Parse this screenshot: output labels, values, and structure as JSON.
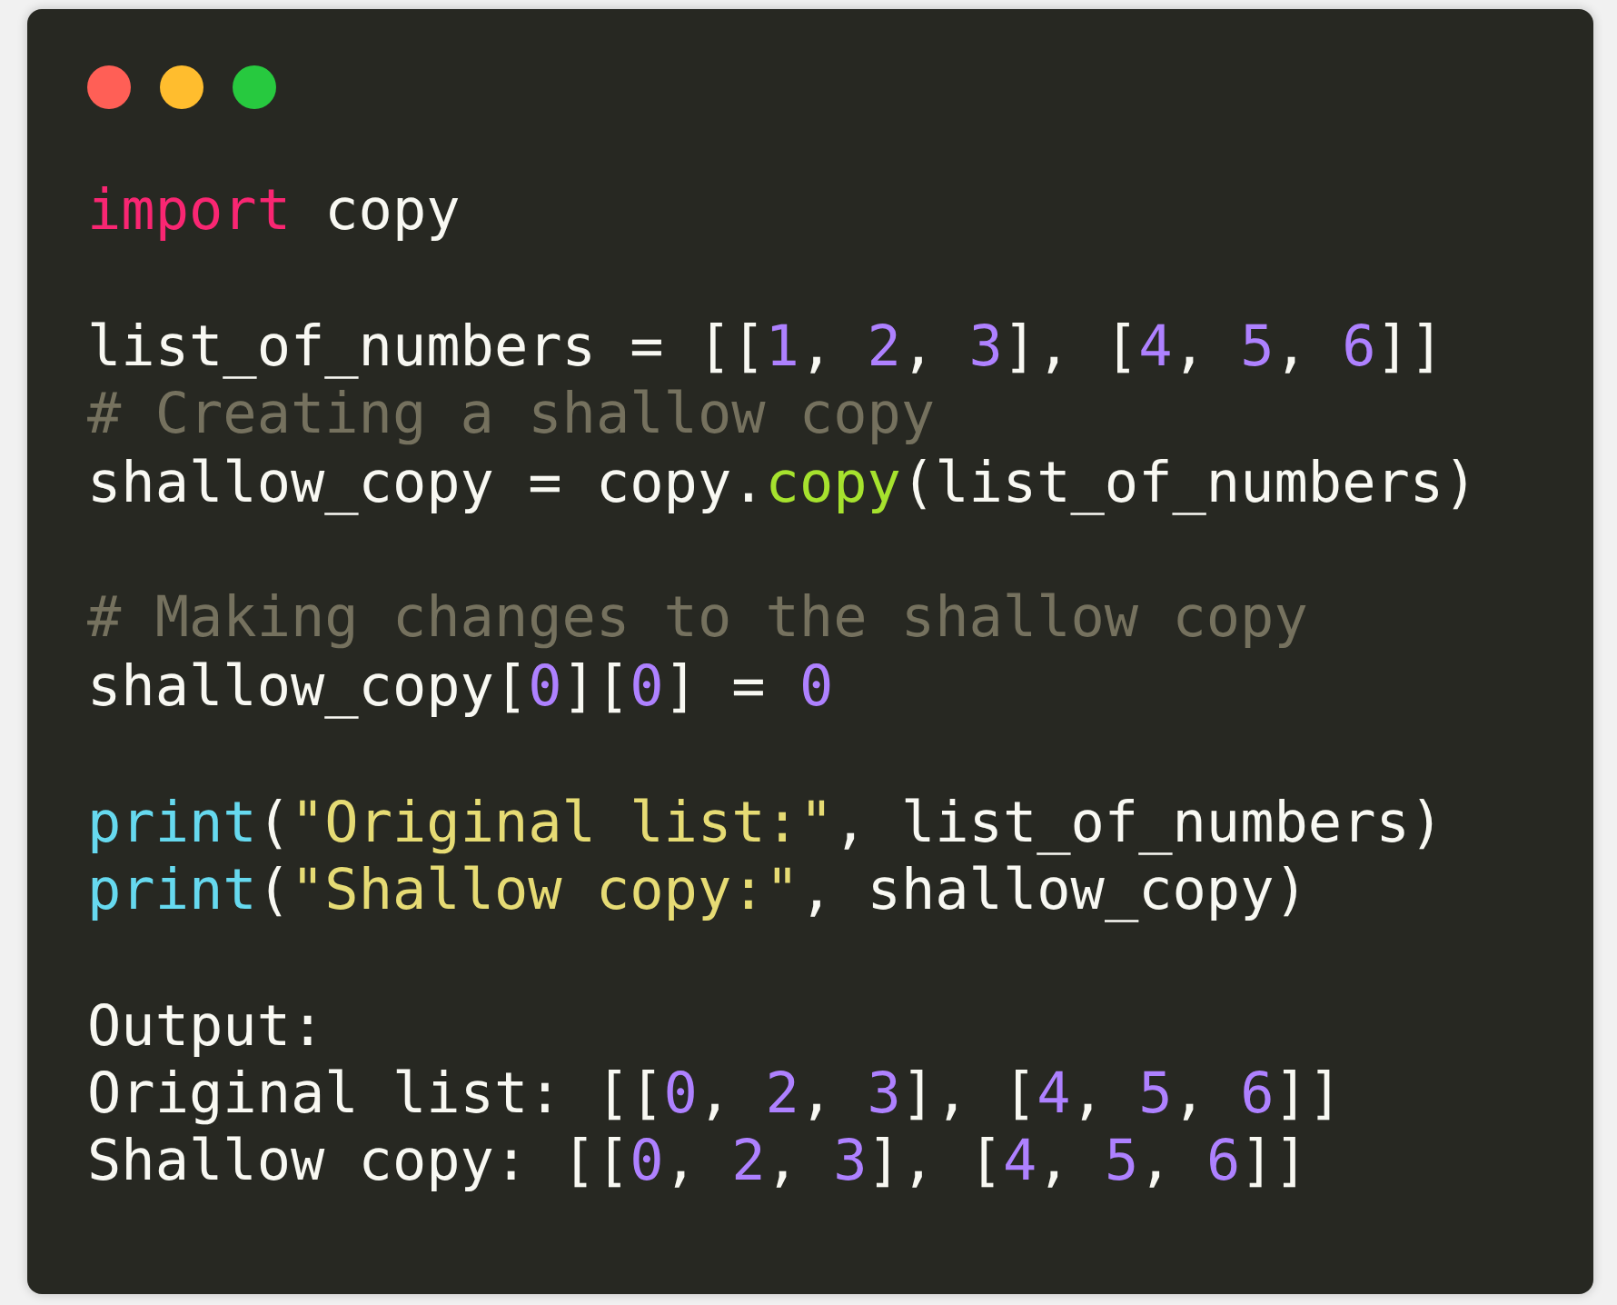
{
  "window_controls": [
    {
      "color": "#ff5f56"
    },
    {
      "color": "#ffbd2e"
    },
    {
      "color": "#27c93f"
    }
  ],
  "code_blocks": [
    [
      {
        "tokens": [
          {
            "kind": "keyword",
            "text": "import"
          },
          {
            "kind": "plain",
            "text": " copy"
          }
        ]
      }
    ],
    [
      {
        "tokens": [
          {
            "kind": "plain",
            "text": "list_of_numbers = [["
          },
          {
            "kind": "number",
            "text": "1"
          },
          {
            "kind": "plain",
            "text": ", "
          },
          {
            "kind": "number",
            "text": "2"
          },
          {
            "kind": "plain",
            "text": ", "
          },
          {
            "kind": "number",
            "text": "3"
          },
          {
            "kind": "plain",
            "text": "], ["
          },
          {
            "kind": "number",
            "text": "4"
          },
          {
            "kind": "plain",
            "text": ", "
          },
          {
            "kind": "number",
            "text": "5"
          },
          {
            "kind": "plain",
            "text": ", "
          },
          {
            "kind": "number",
            "text": "6"
          },
          {
            "kind": "plain",
            "text": "]]"
          }
        ]
      },
      {
        "tokens": [
          {
            "kind": "comment",
            "text": "# Creating a shallow copy"
          }
        ]
      },
      {
        "tokens": [
          {
            "kind": "plain",
            "text": "shallow_copy = copy."
          },
          {
            "kind": "function",
            "text": "copy"
          },
          {
            "kind": "plain",
            "text": "(list_of_numbers)"
          }
        ]
      }
    ],
    [
      {
        "tokens": [
          {
            "kind": "comment",
            "text": "# Making changes to the shallow copy"
          }
        ]
      },
      {
        "tokens": [
          {
            "kind": "plain",
            "text": "shallow_copy["
          },
          {
            "kind": "number",
            "text": "0"
          },
          {
            "kind": "plain",
            "text": "]["
          },
          {
            "kind": "number",
            "text": "0"
          },
          {
            "kind": "plain",
            "text": "] = "
          },
          {
            "kind": "number",
            "text": "0"
          }
        ]
      }
    ],
    [
      {
        "tokens": [
          {
            "kind": "builtin",
            "text": "print"
          },
          {
            "kind": "plain",
            "text": "("
          },
          {
            "kind": "string",
            "text": "\"Original list:\""
          },
          {
            "kind": "plain",
            "text": ", list_of_numbers)"
          }
        ]
      },
      {
        "tokens": [
          {
            "kind": "builtin",
            "text": "print"
          },
          {
            "kind": "plain",
            "text": "("
          },
          {
            "kind": "string",
            "text": "\"Shallow copy:\""
          },
          {
            "kind": "plain",
            "text": ", shallow_copy)"
          }
        ]
      }
    ],
    [
      {
        "tokens": [
          {
            "kind": "plain",
            "text": "Output:"
          }
        ]
      },
      {
        "tokens": [
          {
            "kind": "plain",
            "text": "Original list: [["
          },
          {
            "kind": "number",
            "text": "0"
          },
          {
            "kind": "plain",
            "text": ", "
          },
          {
            "kind": "number",
            "text": "2"
          },
          {
            "kind": "plain",
            "text": ", "
          },
          {
            "kind": "number",
            "text": "3"
          },
          {
            "kind": "plain",
            "text": "], ["
          },
          {
            "kind": "number",
            "text": "4"
          },
          {
            "kind": "plain",
            "text": ", "
          },
          {
            "kind": "number",
            "text": "5"
          },
          {
            "kind": "plain",
            "text": ", "
          },
          {
            "kind": "number",
            "text": "6"
          },
          {
            "kind": "plain",
            "text": "]]"
          }
        ]
      },
      {
        "tokens": [
          {
            "kind": "plain",
            "text": "Shallow copy: [["
          },
          {
            "kind": "number",
            "text": "0"
          },
          {
            "kind": "plain",
            "text": ", "
          },
          {
            "kind": "number",
            "text": "2"
          },
          {
            "kind": "plain",
            "text": ", "
          },
          {
            "kind": "number",
            "text": "3"
          },
          {
            "kind": "plain",
            "text": "], ["
          },
          {
            "kind": "number",
            "text": "4"
          },
          {
            "kind": "plain",
            "text": ", "
          },
          {
            "kind": "number",
            "text": "5"
          },
          {
            "kind": "plain",
            "text": ", "
          },
          {
            "kind": "number",
            "text": "6"
          },
          {
            "kind": "plain",
            "text": "]]"
          }
        ]
      }
    ]
  ]
}
